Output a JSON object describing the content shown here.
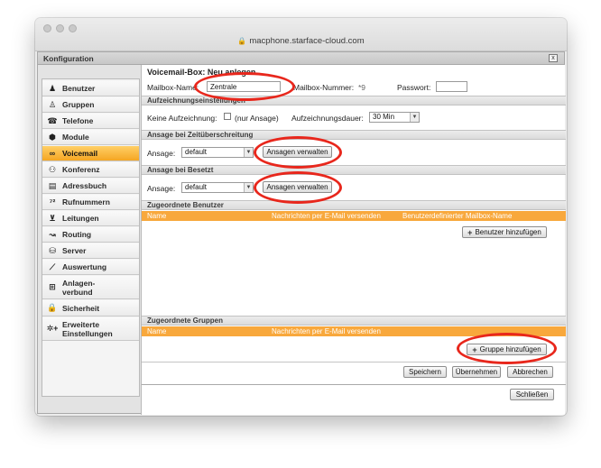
{
  "window": {
    "url": "macphone.starface-cloud.com"
  },
  "app": {
    "title": "Konfiguration",
    "close_label": "x"
  },
  "sidebar": {
    "items": [
      {
        "icon": "user-icon",
        "glyph": "♟",
        "label": "Benutzer"
      },
      {
        "icon": "group-icon",
        "glyph": "♙",
        "label": "Gruppen"
      },
      {
        "icon": "phone-icon",
        "glyph": "☎",
        "label": "Telefone"
      },
      {
        "icon": "module-icon",
        "glyph": "⬢",
        "label": "Module"
      },
      {
        "icon": "voicemail-icon",
        "glyph": "∞",
        "label": "Voicemail"
      },
      {
        "icon": "conference-icon",
        "glyph": "⚇",
        "label": "Konferenz"
      },
      {
        "icon": "addressbook-icon",
        "glyph": "▤",
        "label": "Adressbuch"
      },
      {
        "icon": "numbers-icon",
        "glyph": "⁷²",
        "label": "Rufnummern"
      },
      {
        "icon": "lines-icon",
        "glyph": "⊻",
        "label": "Leitungen"
      },
      {
        "icon": "routing-icon",
        "glyph": "↝",
        "label": "Routing"
      },
      {
        "icon": "server-icon",
        "glyph": "⛁",
        "label": "Server"
      },
      {
        "icon": "chart-icon",
        "glyph": "⟋",
        "label": "Auswertung"
      },
      {
        "icon": "network-icon",
        "glyph": "⊞",
        "label": "Anlagen-\nverbund"
      },
      {
        "icon": "lock-icon",
        "glyph": "🔒",
        "label": "Sicherheit"
      },
      {
        "icon": "settings-icon",
        "glyph": "✲+",
        "label": "Erweiterte\nEinstellungen"
      }
    ],
    "active_index": 4
  },
  "form": {
    "title": "Voicemail-Box: Neu anlegen",
    "mailbox_name_label": "Mailbox-Name:",
    "mailbox_name_value": "Zentrale",
    "mailbox_number_label": "Mailbox-Nummer:",
    "mailbox_number_value": "*9",
    "password_label": "Passwort:",
    "password_value": "",
    "recording": {
      "header": "Aufzeichnungseinstellungen",
      "no_recording_label": "Keine Aufzeichnung:",
      "only_announcement_label": "(nur Ansage)",
      "duration_label": "Aufzeichnungsdauer:",
      "duration_value": "30 Min"
    },
    "timeout": {
      "header": "Ansage bei Zeitüberschreitung",
      "label": "Ansage:",
      "value": "default",
      "manage_button": "Ansagen verwalten"
    },
    "busy": {
      "header": "Ansage bei Besetzt",
      "label": "Ansage:",
      "value": "default",
      "manage_button": "Ansagen verwalten"
    },
    "users": {
      "header": "Zugeordnete Benutzer",
      "columns": [
        "Name",
        "Nachrichten per E-Mail versenden",
        "Benutzerdefinierter Mailbox-Name"
      ],
      "add_button": "Benutzer hinzufügen"
    },
    "groups": {
      "header": "Zugeordnete Gruppen",
      "columns": [
        "Name",
        "Nachrichten per E-Mail versenden"
      ],
      "add_button": "Gruppe hinzufügen"
    },
    "actions": {
      "save": "Speichern",
      "apply": "Übernehmen",
      "cancel": "Abbrechen"
    }
  },
  "footer": {
    "close_button": "Schließen"
  },
  "colors": {
    "accent": "#f8a83c",
    "highlight": "#e8271c"
  }
}
